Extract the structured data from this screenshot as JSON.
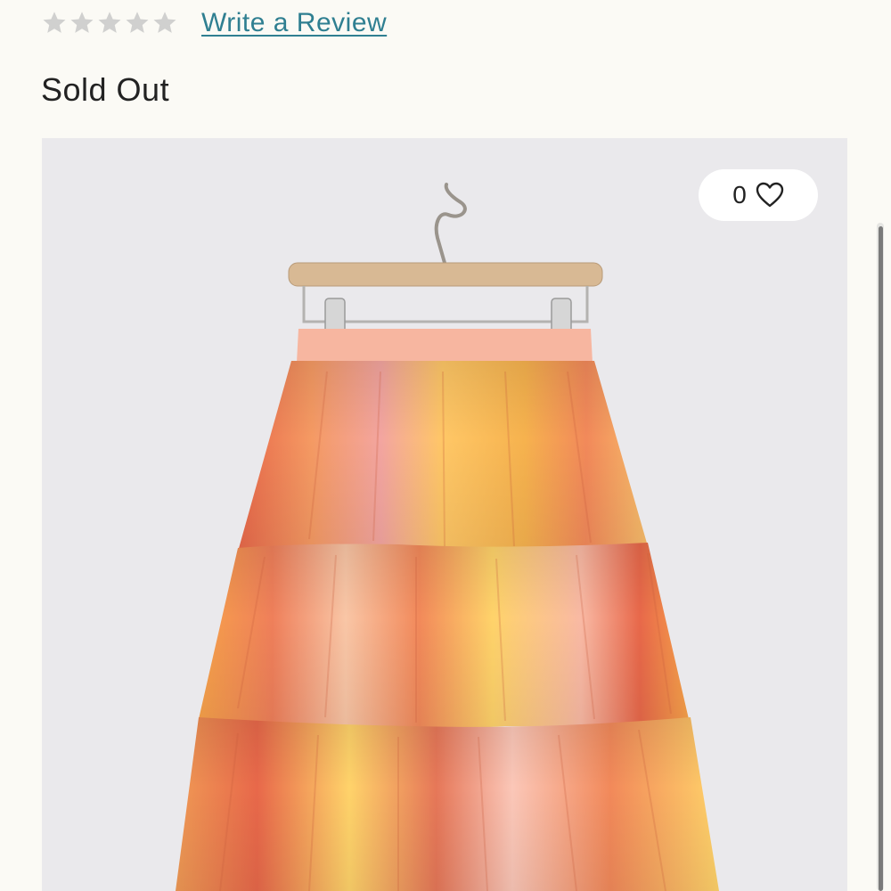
{
  "rating": {
    "stars_total": 5,
    "stars_filled": 0,
    "star_color": "#d0d0cf",
    "review_link": "Write a Review",
    "link_color": "#2f7f91"
  },
  "availability": {
    "status": "Sold Out"
  },
  "product_image": {
    "subject": "tiered tie-dye skirt on hanger",
    "background_color": "#eae9ec",
    "skirt_colors": [
      "#e8684a",
      "#f7a24a",
      "#ffd36a",
      "#f9c6a6",
      "#f2895a"
    ]
  },
  "favorite": {
    "count": "0",
    "icon": "heart-outline-icon"
  },
  "scrollbar": {
    "icon": "vertical-scrollbar"
  }
}
